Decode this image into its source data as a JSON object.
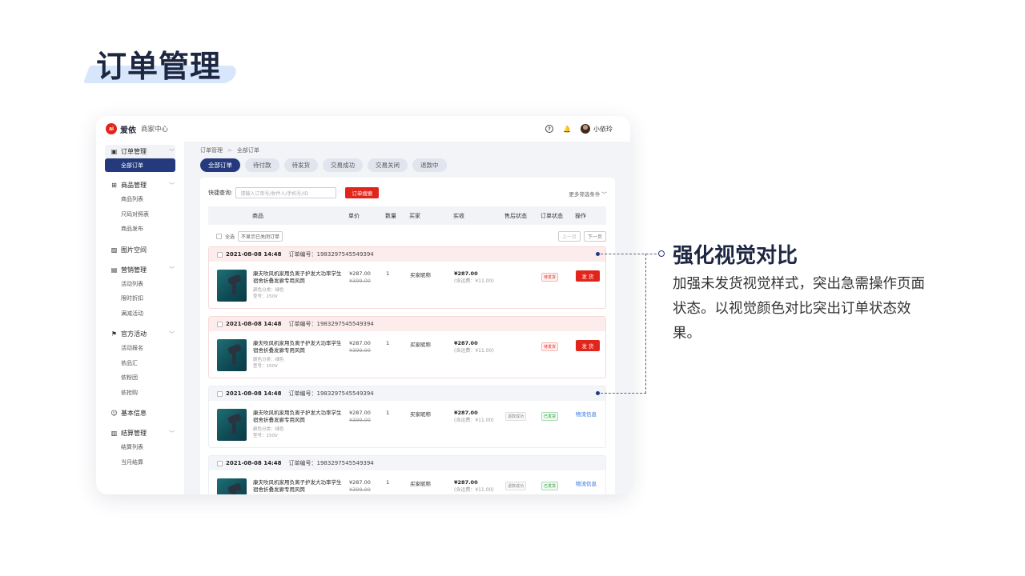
{
  "slide": {
    "title": "订单管理",
    "annotation_title": "强化视觉对比",
    "annotation_body": "加强未发货视觉样式，突出急需操作页面状态。以视觉颜色对比突出订单状态效果。"
  },
  "app": {
    "logo_mark": "ai",
    "logo_text": "爱依",
    "logo_sub": "商家中心",
    "user_name": "小依玲",
    "help_icon_glyph": "?",
    "bell_icon_glyph": "🔔"
  },
  "sidebar": {
    "groups": [
      {
        "label": "订单管理",
        "icon": "clipboard-icon",
        "glyph": "▣",
        "items": [
          "全部订单"
        ]
      },
      {
        "label": "商品管理",
        "icon": "grid-icon",
        "glyph": "⊞",
        "items": [
          "商品列表",
          "尺码对照表",
          "商品发布"
        ]
      },
      {
        "label": "图片空间",
        "icon": "image-icon",
        "glyph": "▨",
        "items": []
      },
      {
        "label": "营销管理",
        "icon": "bag-icon",
        "glyph": "▤",
        "items": [
          "活动列表",
          "限时折扣",
          "满减活动"
        ]
      },
      {
        "label": "官方活动",
        "icon": "flag-icon",
        "glyph": "⚑",
        "items": [
          "活动报名",
          "依品汇",
          "依粉团",
          "依抢购"
        ]
      },
      {
        "label": "基本信息",
        "icon": "user-icon",
        "glyph": "☺",
        "items": []
      },
      {
        "label": "结算管理",
        "icon": "wallet-icon",
        "glyph": "▥",
        "items": [
          "结算列表",
          "当月结算"
        ]
      }
    ]
  },
  "main": {
    "breadcrumb": [
      "订单管理",
      "全部订单"
    ],
    "breadcrumb_sep": ">",
    "tabs": [
      "全部订单",
      "待付款",
      "待发货",
      "交易成功",
      "交易关闭",
      "退款中"
    ],
    "quick_label": "快捷查询:",
    "search_placeholder": "请输入订单号/收件人/手机号/ID",
    "search_button": "订单搜索",
    "more_filter": "更多筛选条件 ﹀",
    "columns": [
      "商品",
      "单价",
      "数量",
      "买家",
      "实收",
      "售后状态",
      "订单状态",
      "操作"
    ],
    "select_all": "全选",
    "hide_closed": "不显示已关闭订单",
    "prev_page": "上一页",
    "next_page": "下一页"
  },
  "orders": [
    {
      "time": "2021-08-08 14:48",
      "order_no": "订单编号：1983297545549394",
      "product": "康夫吹风机家用负离子护发大功率学生宿舍折叠发廊专用风筒",
      "spec_color": "颜色分类：绿色",
      "spec_model": "型号：150V",
      "price": "¥287.00",
      "old_price": "¥399.00",
      "qty": "1",
      "buyer": "买家昵称",
      "paid": "¥287.00",
      "shipping": "(含运费：¥11.00)",
      "after_sale": "",
      "status": "待发货",
      "action": "发 货"
    },
    {
      "time": "2021-08-08 14:48",
      "order_no": "订单编号：1983297545549394",
      "product": "康夫吹风机家用负离子护发大功率学生宿舍折叠发廊专用风筒",
      "spec_color": "颜色分类：绿色",
      "spec_model": "型号：150V",
      "price": "¥287.00",
      "old_price": "¥399.00",
      "qty": "1",
      "buyer": "买家昵称",
      "paid": "¥287.00",
      "shipping": "(含运费：¥11.00)",
      "after_sale": "",
      "status": "待发货",
      "action": "发 货"
    },
    {
      "time": "2021-08-08 14:48",
      "order_no": "订单编号：1983297545549394",
      "product": "康夫吹风机家用负离子护发大功率学生宿舍折叠发廊专用风筒",
      "spec_color": "颜色分类：绿色",
      "spec_model": "型号：150V",
      "price": "¥287.00",
      "old_price": "¥399.00",
      "qty": "1",
      "buyer": "买家昵称",
      "paid": "¥287.00",
      "shipping": "(含运费：¥11.00)",
      "after_sale": "退款成功",
      "status": "已发货",
      "action": "物流信息"
    },
    {
      "time": "2021-08-08 14:48",
      "order_no": "订单编号：1983297545549394",
      "product": "康夫吹风机家用负离子护发大功率学生宿舍折叠发廊专用风筒",
      "spec_color": "",
      "spec_model": "",
      "price": "¥287.00",
      "old_price": "¥399.00",
      "qty": "1",
      "buyer": "买家昵称",
      "paid": "¥287.00",
      "shipping": "(含运费：¥11.00)",
      "after_sale": "退款成功",
      "status": "已发货",
      "action": "物流信息"
    }
  ],
  "colors": {
    "brand_red": "#e1251b",
    "accent_navy": "#253a7d",
    "pending_bg": "#fdecec",
    "link_blue": "#2f6fe0",
    "success_green": "#2b9d3a"
  }
}
